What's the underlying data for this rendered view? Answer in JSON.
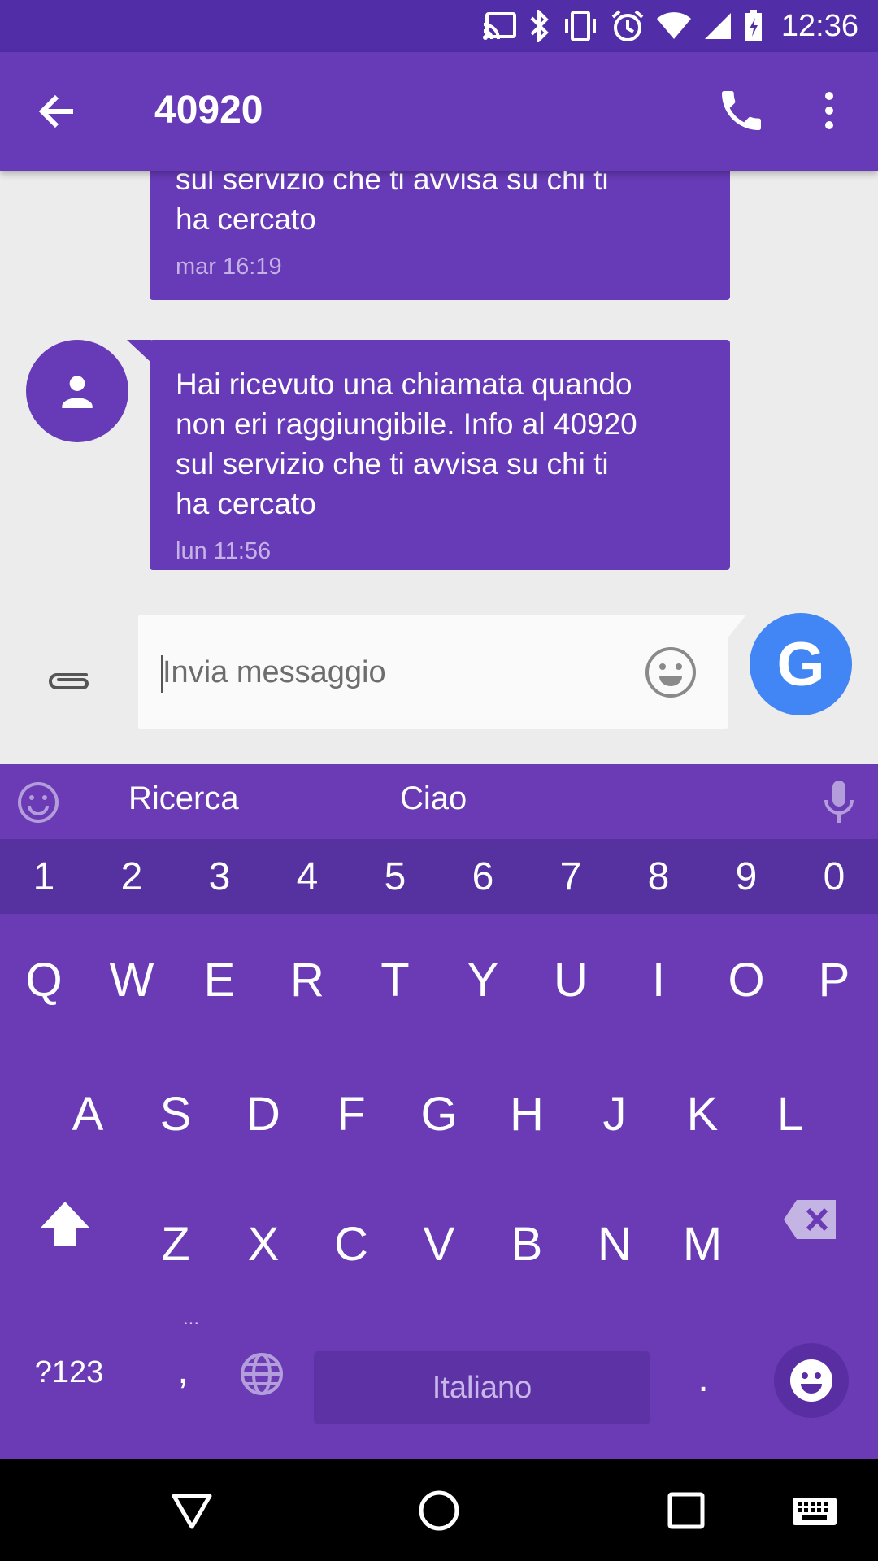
{
  "status_bar": {
    "time": "12:36",
    "icons": [
      "cast-icon",
      "bluetooth-icon",
      "vibrate-icon",
      "alarm-icon",
      "wifi-icon",
      "signal-icon",
      "battery-charging-icon"
    ]
  },
  "app_bar": {
    "title": "40920",
    "back_icon": "arrow-back-icon",
    "call_icon": "phone-icon",
    "more_icon": "more-vert-icon"
  },
  "messages": [
    {
      "text_lines": [
        "sul servizio che ti avvisa su chi ti",
        "ha cercato"
      ],
      "timestamp": "mar 16:19"
    },
    {
      "text_lines": [
        "Hai ricevuto una chiamata quando",
        "non eri raggiungibile. Info al 40920",
        "sul servizio che ti avvisa su chi ti",
        "ha cercato"
      ],
      "timestamp": "lun 11:56"
    }
  ],
  "compose": {
    "placeholder": "Invia messaggio",
    "send_label": "G"
  },
  "keyboard": {
    "suggestions": [
      "Ricerca",
      "Ciao"
    ],
    "number_row": [
      "1",
      "2",
      "3",
      "4",
      "5",
      "6",
      "7",
      "8",
      "9",
      "0"
    ],
    "row1": [
      "Q",
      "W",
      "E",
      "R",
      "T",
      "Y",
      "U",
      "I",
      "O",
      "P"
    ],
    "row2": [
      "A",
      "S",
      "D",
      "F",
      "G",
      "H",
      "J",
      "K",
      "L"
    ],
    "row3": [
      "Z",
      "X",
      "C",
      "V",
      "B",
      "N",
      "M"
    ],
    "symbols_label": "?123",
    "comma": ",",
    "comma_hint": "...",
    "space_label": "Italiano",
    "period": "."
  },
  "colors": {
    "primary": "#673ab7",
    "primary_dark": "#512da8",
    "send_button": "#4285f4"
  }
}
